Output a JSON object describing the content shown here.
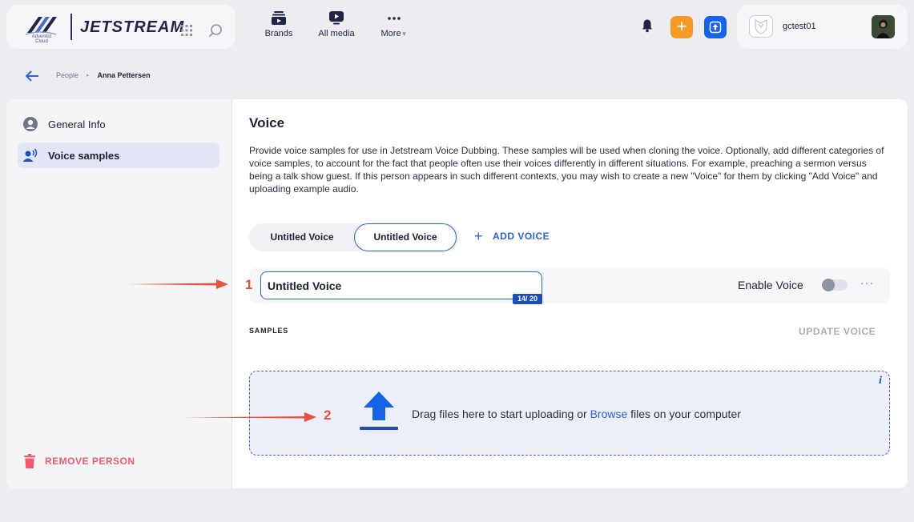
{
  "header": {
    "logo_sub": "Adventist Cloud",
    "logo_word": "JETSTREAM",
    "nav": [
      {
        "label": "Brands",
        "icon": "brands-icon"
      },
      {
        "label": "All media",
        "icon": "media-icon"
      },
      {
        "label": "More",
        "icon": "more-dots-icon"
      }
    ],
    "add_button_label": "+",
    "username": "gctest01"
  },
  "breadcrumb": {
    "parent": "People",
    "separator": "▸",
    "current": "Anna Pettersen"
  },
  "sidebar": {
    "items": [
      {
        "label": "General Info",
        "icon": "person-circle-icon",
        "active": false
      },
      {
        "label": "Voice samples",
        "icon": "voice-icon",
        "active": true
      }
    ],
    "remove_label": "REMOVE PERSON"
  },
  "main": {
    "title": "Voice",
    "description": "Provide voice samples for use in Jetstream Voice Dubbing. These samples will be used when cloning the voice. Optionally, add different categories of voice samples, to account for the fact that people often use their voices differently in different situations. For example, preaching a sermon versus being a talk show guest. If this person appears in such different contexts, you may wish to create a new \"Voice\" for them by clicking \"Add Voice\" and uploading example audio.",
    "voice_tabs": [
      {
        "label": "Untitled Voice",
        "active": false
      },
      {
        "label": "Untitled Voice",
        "active": true
      }
    ],
    "add_voice_label": "ADD VOICE",
    "voice_name_value": "Untitled Voice",
    "char_count": "14/ 20",
    "enable_label": "Enable Voice",
    "enable_on": false,
    "more_label": "···",
    "samples_label": "SAMPLES",
    "update_label": "UPDATE VOICE",
    "dropzone": {
      "text_before": "Drag files here to start uploading or ",
      "browse": "Browse",
      "text_after": " files on your computer",
      "info": "i"
    }
  },
  "annotations": [
    {
      "number": "1"
    },
    {
      "number": "2"
    }
  ],
  "colors": {
    "accent": "#2b62d6",
    "danger": "#ee5a70",
    "orange": "#f79a25",
    "annotation": "#e0533d"
  }
}
